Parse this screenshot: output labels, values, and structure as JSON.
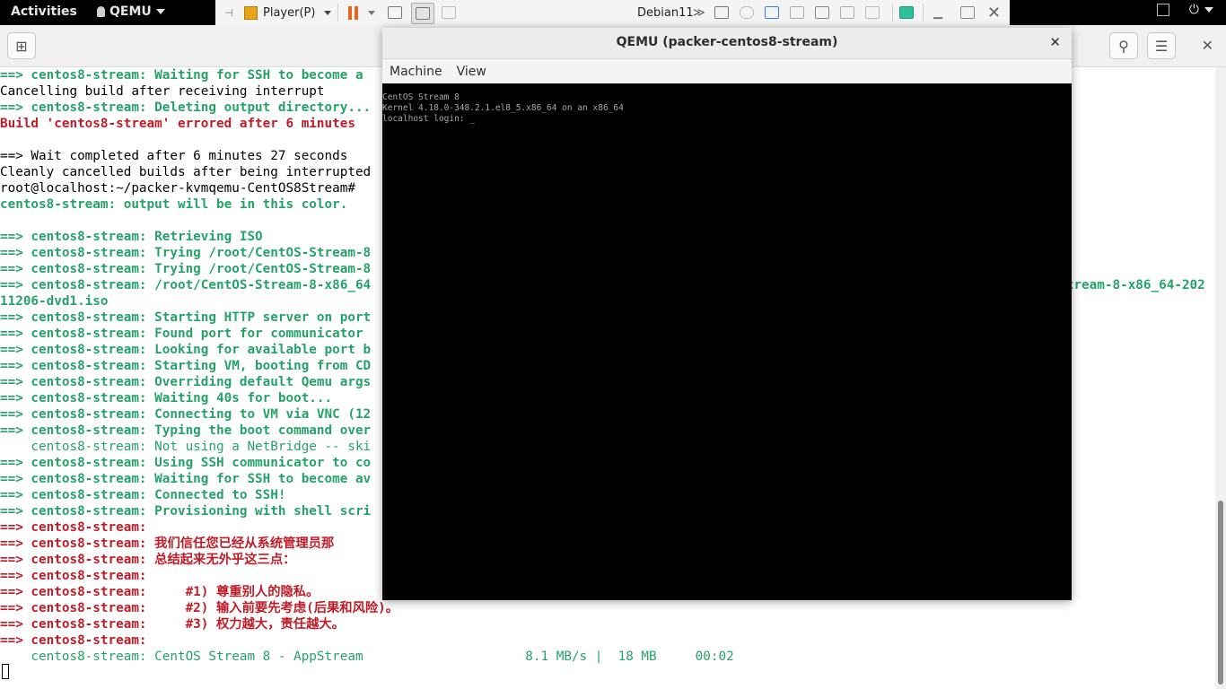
{
  "topbar": {
    "activities": "Activities",
    "app_name": "QEMU"
  },
  "vmware": {
    "player_menu": "Player(P)",
    "vm_name": "Debian11"
  },
  "terminal": {
    "lines": [
      {
        "parts": [
          {
            "t": "==> centos8-stream: Waiting for SSH to become a",
            "c": "gb"
          }
        ]
      },
      {
        "parts": [
          {
            "t": "Cancelling build after receiving interrupt",
            "c": "k"
          }
        ]
      },
      {
        "parts": [
          {
            "t": "==> centos8-stream: Deleting output directory...",
            "c": "gb"
          }
        ]
      },
      {
        "parts": [
          {
            "t": "Build 'centos8-stream' errored after 6 minutes ",
            "c": "rb"
          }
        ]
      },
      {
        "parts": [
          {
            "t": "",
            "c": "k"
          }
        ]
      },
      {
        "parts": [
          {
            "t": "==> Wait completed after 6 minutes 27 seconds",
            "c": "k"
          }
        ]
      },
      {
        "parts": [
          {
            "t": "Cleanly cancelled builds after being interrupted",
            "c": "k"
          }
        ]
      },
      {
        "parts": [
          {
            "t": "root@localhost:~/packer-kvmqemu-CentOS8Stream# ",
            "c": "k"
          }
        ]
      },
      {
        "parts": [
          {
            "t": "centos8-stream: output will be in this color.",
            "c": "gb"
          }
        ]
      },
      {
        "parts": [
          {
            "t": "",
            "c": "k"
          }
        ]
      },
      {
        "parts": [
          {
            "t": "==> centos8-stream: Retrieving ISO",
            "c": "gb"
          }
        ]
      },
      {
        "parts": [
          {
            "t": "==> centos8-stream: Trying /root/CentOS-Stream-8",
            "c": "gb"
          }
        ]
      },
      {
        "parts": [
          {
            "t": "==> centos8-stream: Trying /root/CentOS-Stream-8",
            "c": "gb"
          }
        ]
      },
      {
        "parts": [
          {
            "t": "==> centos8-stream: /root/CentOS-Stream-8-x86_64",
            "c": "gb"
          },
          {
            "t": "                                                                                          tream-8-x86_64-202",
            "c": "gb"
          }
        ]
      },
      {
        "parts": [
          {
            "t": "11206-dvd1.iso",
            "c": "gb"
          }
        ]
      },
      {
        "parts": [
          {
            "t": "==> centos8-stream: Starting HTTP server on port",
            "c": "gb"
          }
        ]
      },
      {
        "parts": [
          {
            "t": "==> centos8-stream: Found port for communicator",
            "c": "gb"
          }
        ]
      },
      {
        "parts": [
          {
            "t": "==> centos8-stream: Looking for available port b",
            "c": "gb"
          }
        ]
      },
      {
        "parts": [
          {
            "t": "==> centos8-stream: Starting VM, booting from CD",
            "c": "gb"
          }
        ]
      },
      {
        "parts": [
          {
            "t": "==> centos8-stream: Overriding default Qemu args",
            "c": "gb"
          }
        ]
      },
      {
        "parts": [
          {
            "t": "==> centos8-stream: Waiting 40s for boot...",
            "c": "gb"
          }
        ]
      },
      {
        "parts": [
          {
            "t": "==> centos8-stream: Connecting to VM via VNC (12",
            "c": "gb"
          }
        ]
      },
      {
        "parts": [
          {
            "t": "==> centos8-stream: Typing the boot command over",
            "c": "gb"
          }
        ]
      },
      {
        "parts": [
          {
            "t": "    centos8-stream: Not using a NetBridge -- ski",
            "c": "g"
          }
        ]
      },
      {
        "parts": [
          {
            "t": "==> centos8-stream: Using SSH communicator to co",
            "c": "gb"
          }
        ]
      },
      {
        "parts": [
          {
            "t": "==> centos8-stream: Waiting for SSH to become av",
            "c": "gb"
          }
        ]
      },
      {
        "parts": [
          {
            "t": "==> centos8-stream: Connected to SSH!",
            "c": "gb"
          }
        ]
      },
      {
        "parts": [
          {
            "t": "==> centos8-stream: Provisioning with shell scri",
            "c": "gb"
          }
        ]
      },
      {
        "parts": [
          {
            "t": "==> centos8-stream:",
            "c": "rb"
          }
        ]
      },
      {
        "parts": [
          {
            "t": "==> centos8-stream: 我们信任您已经从系统管理员那",
            "c": "rb"
          }
        ]
      },
      {
        "parts": [
          {
            "t": "==> centos8-stream: 总结起来无外乎这三点：",
            "c": "rb"
          }
        ]
      },
      {
        "parts": [
          {
            "t": "==> centos8-stream:",
            "c": "rb"
          }
        ]
      },
      {
        "parts": [
          {
            "t": "==> centos8-stream:     #1) 尊重别人的隐私。",
            "c": "rb"
          }
        ]
      },
      {
        "parts": [
          {
            "t": "==> centos8-stream:     #2) 输入前要先考虑(后果和风险)。",
            "c": "rb"
          }
        ]
      },
      {
        "parts": [
          {
            "t": "==> centos8-stream:     #3) 权力越大，责任越大。",
            "c": "rb"
          }
        ]
      },
      {
        "parts": [
          {
            "t": "==> centos8-stream:",
            "c": "rb"
          }
        ]
      },
      {
        "parts": [
          {
            "t": "    centos8-stream: CentOS Stream 8 - AppStream                     8.1 MB/s |  18 MB     00:02",
            "c": "g"
          }
        ]
      }
    ]
  },
  "qemu": {
    "title": "QEMU (packer-centos8-stream)",
    "menu": [
      "Machine",
      "View"
    ],
    "console": [
      "CentOS Stream 8",
      "Kernel 4.18.0-348.2.1.el8_5.x86_64 on an x86_64",
      "",
      "localhost login: _"
    ]
  }
}
